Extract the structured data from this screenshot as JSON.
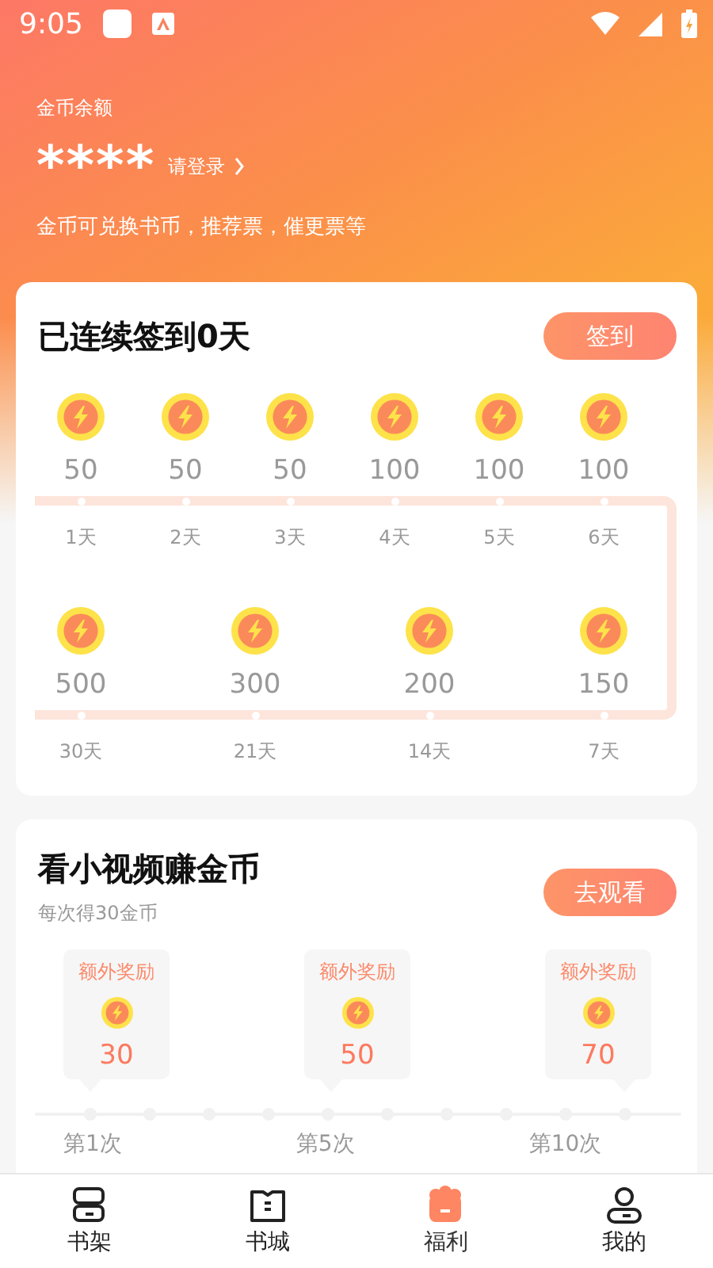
{
  "status_bar": {
    "time": "9:05"
  },
  "balance": {
    "label": "金币余额",
    "value": "****",
    "login_link": "请登录",
    "note": "金币可兑换书币，推荐票，催更票等"
  },
  "checkin": {
    "title": "已连续签到0天",
    "button": "签到",
    "top_row": [
      {
        "coins": "50",
        "day": "1天"
      },
      {
        "coins": "50",
        "day": "2天"
      },
      {
        "coins": "50",
        "day": "3天"
      },
      {
        "coins": "100",
        "day": "4天"
      },
      {
        "coins": "100",
        "day": "5天"
      },
      {
        "coins": "100",
        "day": "6天"
      }
    ],
    "bottom_row": [
      {
        "coins": "500",
        "day": "30天"
      },
      {
        "coins": "300",
        "day": "21天"
      },
      {
        "coins": "200",
        "day": "14天"
      },
      {
        "coins": "150",
        "day": "7天"
      }
    ]
  },
  "video": {
    "title": "看小视频赚金币",
    "subtitle": "每次得30金币",
    "button": "去观看",
    "bonuses": [
      {
        "label": "额外奖励",
        "amount": "30"
      },
      {
        "label": "额外奖励",
        "amount": "50"
      },
      {
        "label": "额外奖励",
        "amount": "70"
      }
    ],
    "steps": [
      "第1次",
      "第5次",
      "第10次"
    ]
  },
  "tabs": [
    {
      "label": "书架",
      "kind": "shelf",
      "selected": false
    },
    {
      "label": "书城",
      "kind": "store",
      "selected": false
    },
    {
      "label": "福利",
      "kind": "gift",
      "selected": true
    },
    {
      "label": "我的",
      "kind": "profile",
      "selected": false
    }
  ]
}
